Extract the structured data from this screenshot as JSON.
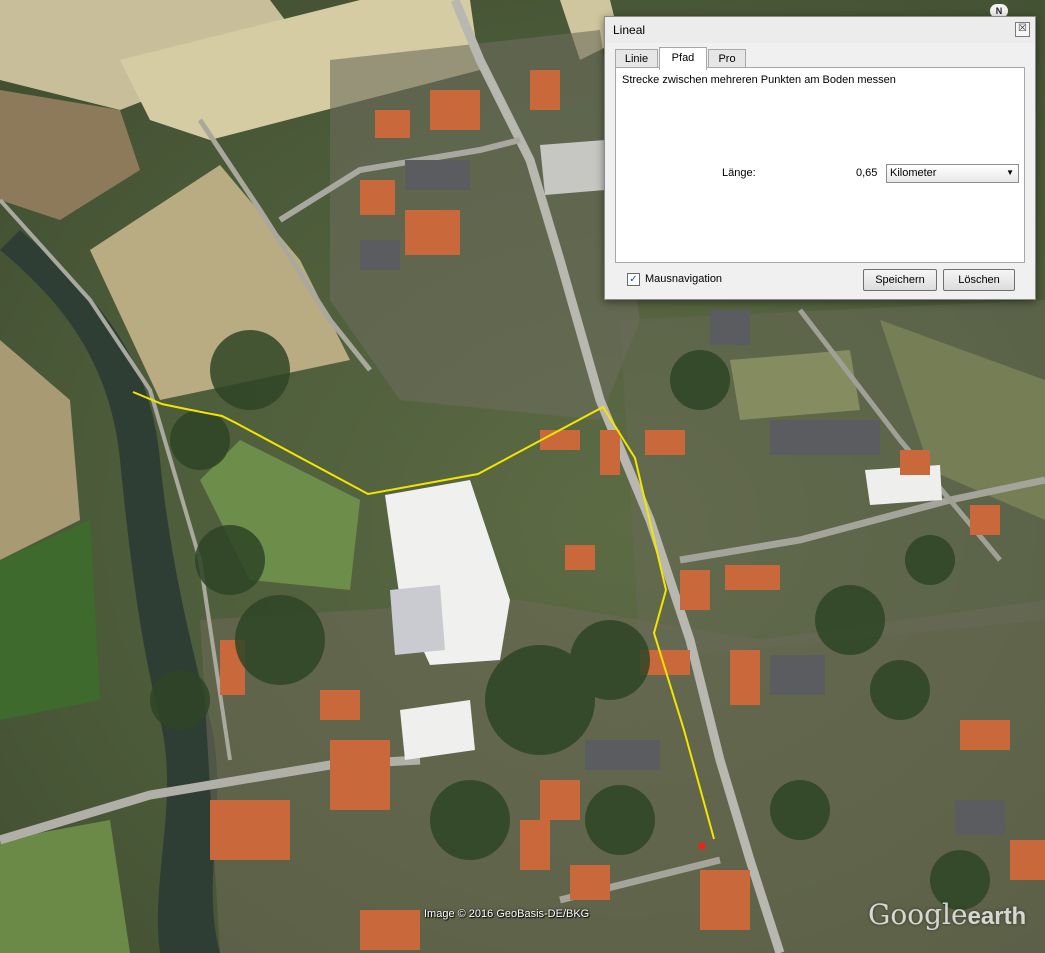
{
  "map": {
    "credit": "Image © 2016 GeoBasis-DE/BKG",
    "brand_google": "Google",
    "brand_earth": "earth",
    "north_label": "N",
    "path_color": "#f2e600",
    "marker_color": "#ff1a1a"
  },
  "dialog": {
    "title": "Lineal",
    "close_label": "☒",
    "tabs": [
      {
        "label": "Linie",
        "active": false
      },
      {
        "label": "Pfad",
        "active": true
      },
      {
        "label": "Pro",
        "active": false
      }
    ],
    "description": "Strecke zwischen mehreren Punkten am Boden messen",
    "length_label": "Länge:",
    "length_value": "0,65",
    "unit_selected": "Kilometer",
    "mouse_nav_checked": true,
    "mouse_nav_label": "Mausnavigation",
    "save_label": "Speichern",
    "clear_label": "Löschen"
  }
}
